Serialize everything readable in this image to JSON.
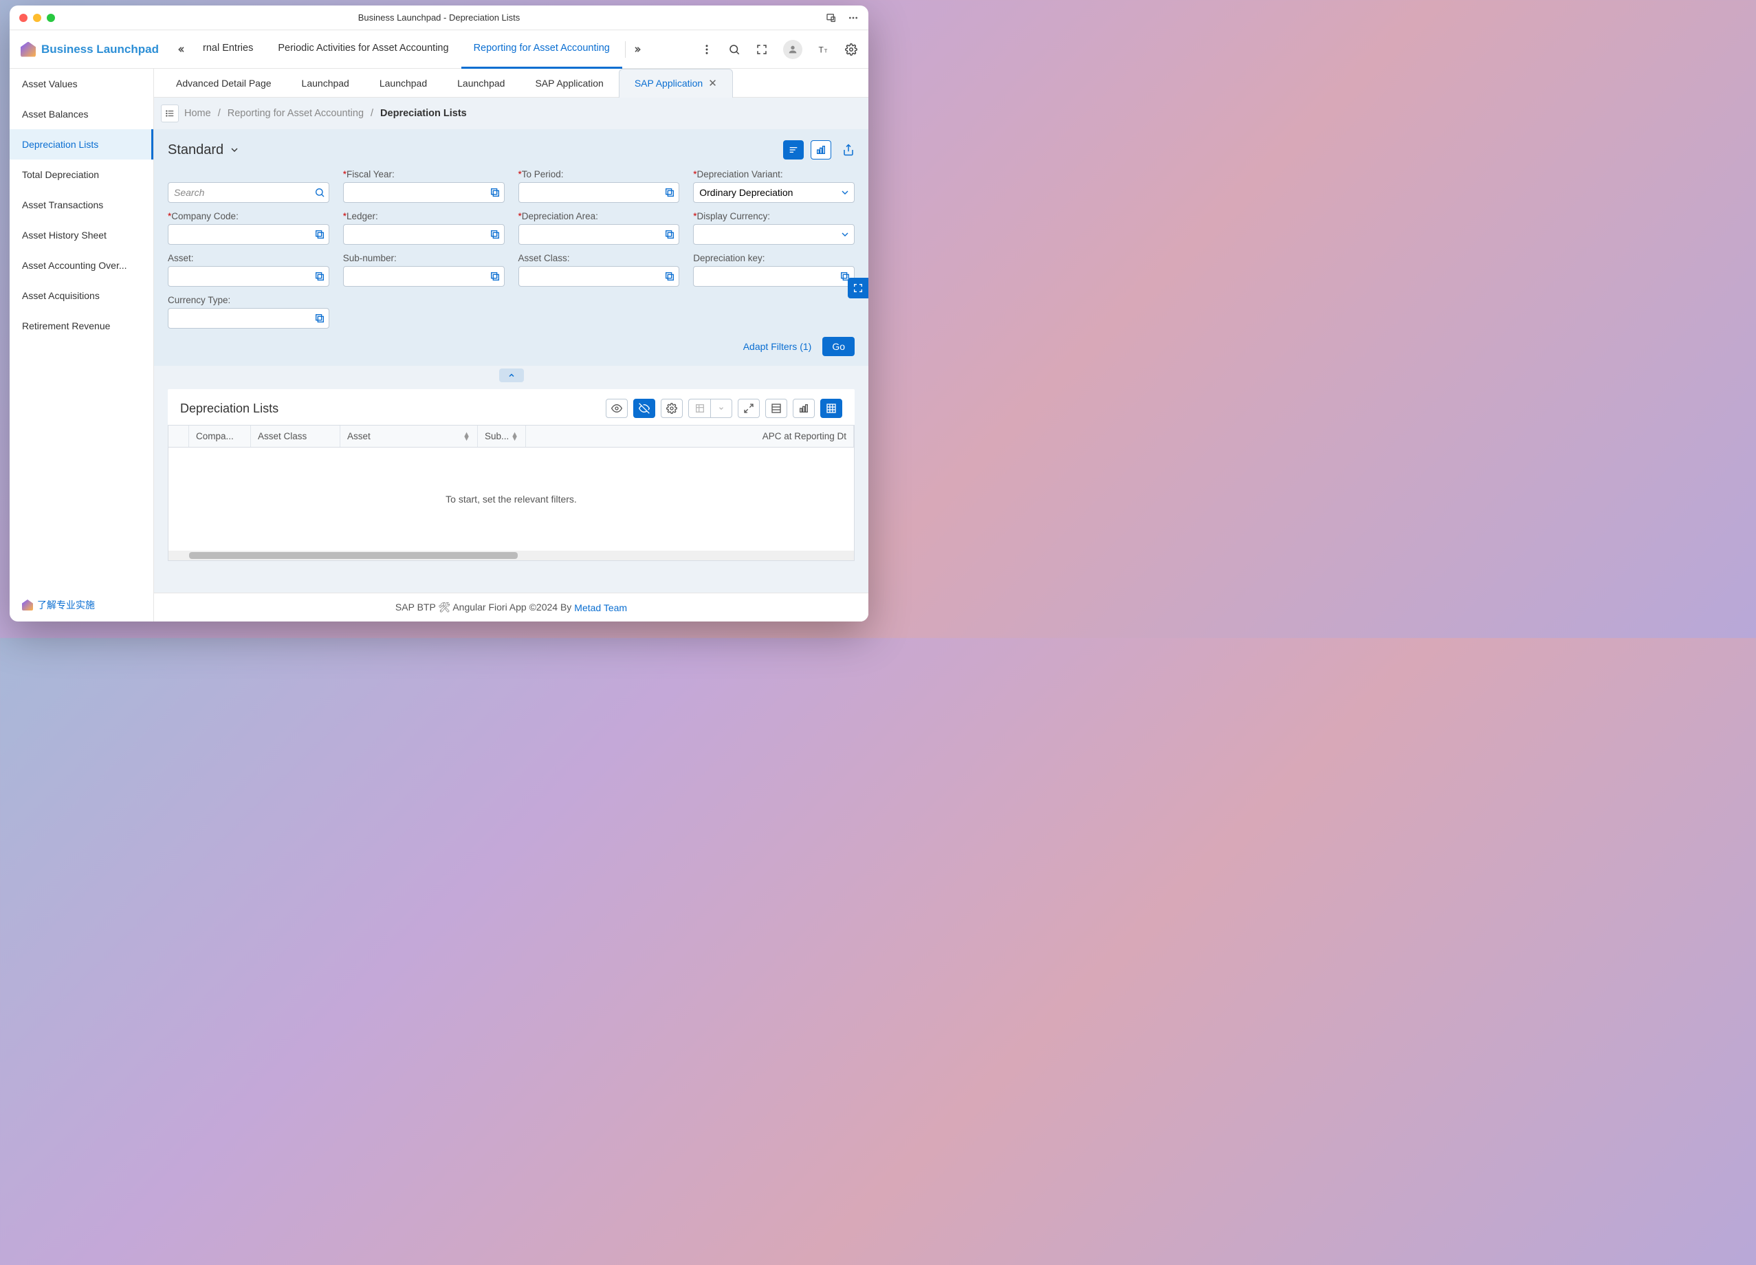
{
  "window_title": "Business Launchpad - Depreciation Lists",
  "brand": "Business Launchpad",
  "topnav": {
    "items": [
      {
        "label": "rnal Entries"
      },
      {
        "label": "Periodic Activities for Asset Accounting"
      },
      {
        "label": "Reporting for Asset Accounting",
        "active": true
      }
    ]
  },
  "sidebar": {
    "items": [
      {
        "label": "Asset Values"
      },
      {
        "label": "Asset Balances"
      },
      {
        "label": "Depreciation Lists",
        "active": true
      },
      {
        "label": "Total Depreciation"
      },
      {
        "label": "Asset Transactions"
      },
      {
        "label": "Asset History Sheet"
      },
      {
        "label": "Asset Accounting Over..."
      },
      {
        "label": "Asset Acquisitions"
      },
      {
        "label": "Retirement Revenue"
      }
    ],
    "footer_label": "了解专业实施"
  },
  "tabs": [
    {
      "label": "Advanced Detail Page"
    },
    {
      "label": "Launchpad"
    },
    {
      "label": "Launchpad"
    },
    {
      "label": "Launchpad"
    },
    {
      "label": "SAP Application"
    },
    {
      "label": "SAP Application",
      "active": true
    }
  ],
  "breadcrumb": {
    "home": "Home",
    "parent": "Reporting for Asset Accounting",
    "current": "Depreciation Lists"
  },
  "variant": "Standard",
  "filters": {
    "search_placeholder": "Search",
    "fiscal_year": {
      "label": "Fiscal Year:",
      "required": true
    },
    "to_period": {
      "label": "To Period:",
      "required": true
    },
    "depreciation_variant": {
      "label": "Depreciation Variant:",
      "required": true,
      "value": "Ordinary Depreciation"
    },
    "company_code": {
      "label": "Company Code:",
      "required": true
    },
    "ledger": {
      "label": "Ledger:",
      "required": true
    },
    "depreciation_area": {
      "label": "Depreciation Area:",
      "required": true
    },
    "display_currency": {
      "label": "Display Currency:",
      "required": true
    },
    "asset": {
      "label": "Asset:"
    },
    "sub_number": {
      "label": "Sub-number:"
    },
    "asset_class": {
      "label": "Asset Class:"
    },
    "depreciation_key": {
      "label": "Depreciation key:"
    },
    "currency_type": {
      "label": "Currency Type:"
    }
  },
  "adapt_filters": "Adapt Filters (1)",
  "go_label": "Go",
  "table": {
    "title": "Depreciation Lists",
    "columns": [
      "",
      "Compa...",
      "Asset Class",
      "Asset",
      "Sub...",
      "APC at Reporting Dt"
    ],
    "empty_message": "To start, set the relevant filters."
  },
  "footer": {
    "text_before": "SAP BTP 🛠 Angular Fiori App ©2024 By ",
    "link": "Metad Team"
  }
}
